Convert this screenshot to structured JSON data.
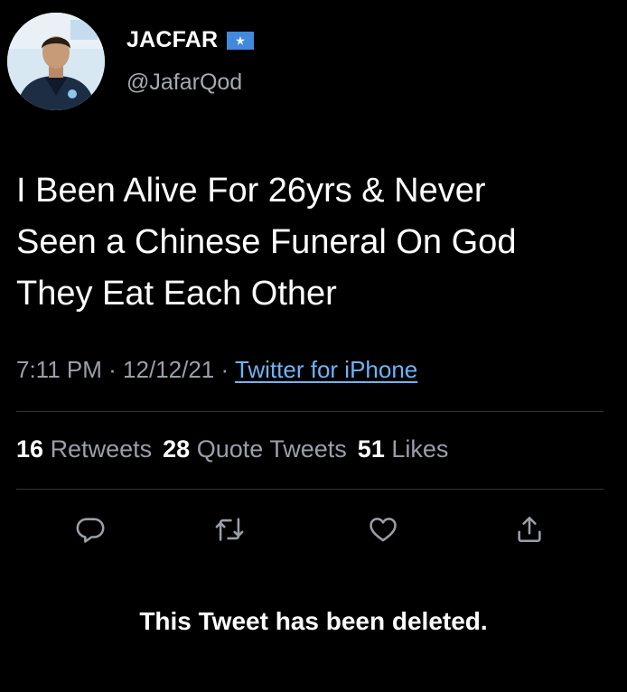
{
  "author": {
    "display_name": "JACFAR",
    "handle": "@JafarQod",
    "flag_icon": "somalia-flag-icon",
    "flag_color": "#4189dd"
  },
  "tweet": {
    "text_lines": [
      "I Been Alive For 26yrs & Never",
      "Seen a Chinese Funeral On God",
      "They Eat Each Other"
    ],
    "time": "7:11 PM",
    "separator": "·",
    "date": "12/12/21",
    "source": "Twitter for iPhone"
  },
  "stats": {
    "retweets_count": "16",
    "retweets_label": "Retweets",
    "quotes_count": "28",
    "quotes_label": "Quote Tweets",
    "likes_count": "51",
    "likes_label": "Likes"
  },
  "actions": [
    {
      "name": "reply",
      "icon": "reply-icon"
    },
    {
      "name": "retweet",
      "icon": "retweet-icon"
    },
    {
      "name": "like",
      "icon": "heart-icon"
    },
    {
      "name": "share",
      "icon": "share-icon"
    }
  ],
  "notice": {
    "deleted_text": "This Tweet has been deleted."
  },
  "colors": {
    "background": "#000000",
    "text": "#ffffff",
    "secondary_text": "#98a0a8",
    "link": "#6fb3f5",
    "divider": "#2f3336"
  }
}
